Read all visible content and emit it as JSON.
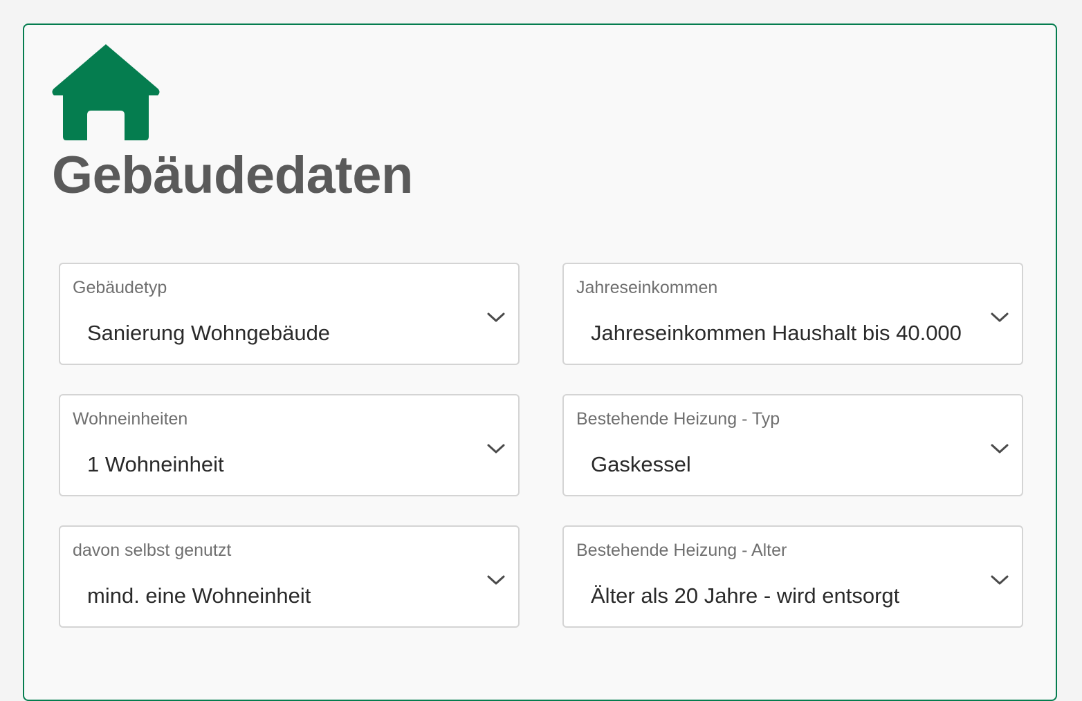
{
  "section": {
    "title": "Gebäudedaten",
    "icon": "house-icon",
    "accent_color": "#057d4f"
  },
  "fields": {
    "gebaeudetyp": {
      "label": "Gebäudetyp",
      "value": "Sanierung Wohngebäude"
    },
    "jahreseinkommen": {
      "label": "Jahreseinkommen",
      "value": "Jahreseinkommen Haushalt bis 40.000"
    },
    "wohneinheiten": {
      "label": "Wohneinheiten",
      "value": "1 Wohneinheit"
    },
    "heizung_typ": {
      "label": "Bestehende Heizung - Typ",
      "value": "Gaskessel"
    },
    "selbst_genutzt": {
      "label": "davon selbst genutzt",
      "value": "mind. eine Wohneinheit"
    },
    "heizung_alter": {
      "label": "Bestehende Heizung - Alter",
      "value": "Älter als 20 Jahre - wird entsorgt"
    }
  }
}
